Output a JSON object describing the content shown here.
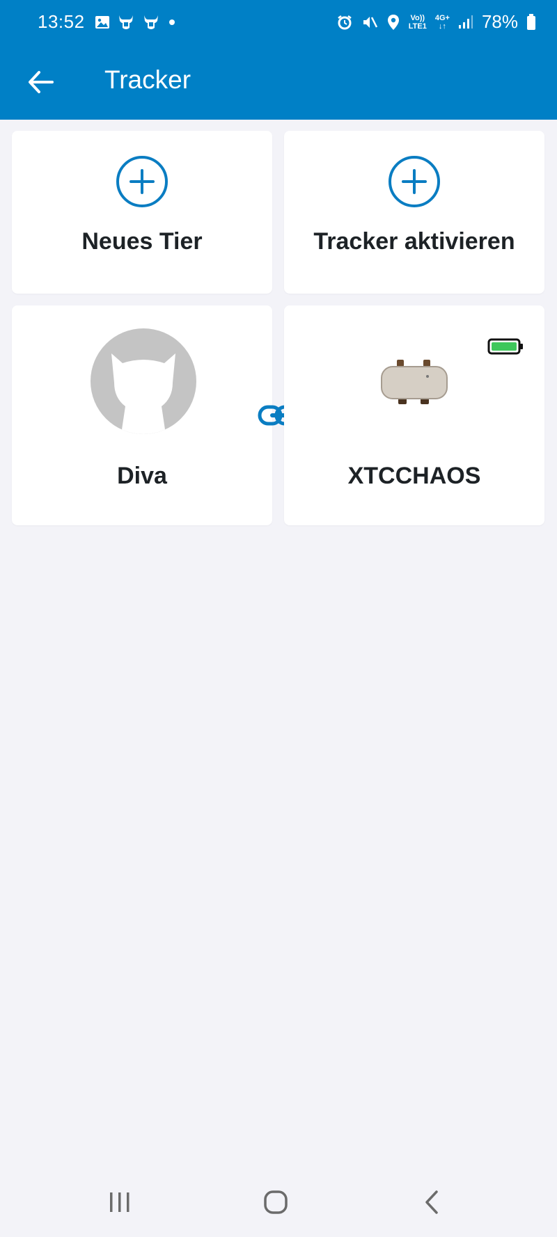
{
  "status_bar": {
    "time": "13:52",
    "network_top": "Vo))",
    "network_bottom": "LTE1",
    "network_type": "4G+",
    "battery": "78%"
  },
  "header": {
    "title": "Tracker",
    "background_color": "#0080c6"
  },
  "actions": [
    {
      "label": "Neues Tier",
      "icon": "plus-circle-icon"
    },
    {
      "label": "Tracker aktivieren",
      "icon": "plus-circle-icon"
    }
  ],
  "pet": {
    "name": "Diva",
    "avatar": "cat-silhouette-icon"
  },
  "tracker": {
    "name": "XTCCHAOS",
    "battery_icon": "battery-full-icon",
    "battery_color": "#3ec75b"
  },
  "link_icon": "link-icon",
  "colors": {
    "accent": "#0a7dc2",
    "card": "#ffffff",
    "background": "#f3f3f8",
    "text": "#1d2226"
  }
}
